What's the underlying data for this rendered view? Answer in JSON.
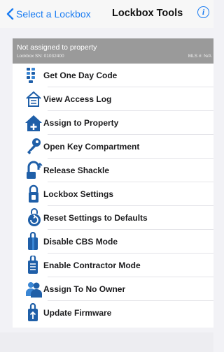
{
  "nav": {
    "back_label": "Select a Lockbox",
    "title": "Lockbox Tools",
    "info_symbol": "i"
  },
  "header": {
    "title": "Not assigned to property",
    "serial": "Lockbox SN: 01032400",
    "mls": "MLS #: N/A"
  },
  "menu": {
    "items": [
      {
        "label": "Get One Day Code",
        "icon": "keypad-code-icon"
      },
      {
        "label": "View Access Log",
        "icon": "house-log-icon"
      },
      {
        "label": "Assign to Property",
        "icon": "house-plus-icon"
      },
      {
        "label": "Open Key Compartment",
        "icon": "key-icon"
      },
      {
        "label": "Release Shackle",
        "icon": "shackle-icon"
      },
      {
        "label": "Lockbox Settings",
        "icon": "lockbox-settings-icon"
      },
      {
        "label": "Reset Settings to Defaults",
        "icon": "reset-icon"
      },
      {
        "label": "Disable CBS Mode",
        "icon": "cbs-lockbox-icon"
      },
      {
        "label": "Enable Contractor Mode",
        "icon": "contractor-lockbox-icon"
      },
      {
        "label": "Assign To No Owner",
        "icon": "users-icon"
      },
      {
        "label": "Update Firmware",
        "icon": "firmware-update-icon"
      }
    ]
  },
  "colors": {
    "accent": "#1a7cf2",
    "icon_blue": "#1f5fa8",
    "header_gray": "#9a9a9a"
  }
}
